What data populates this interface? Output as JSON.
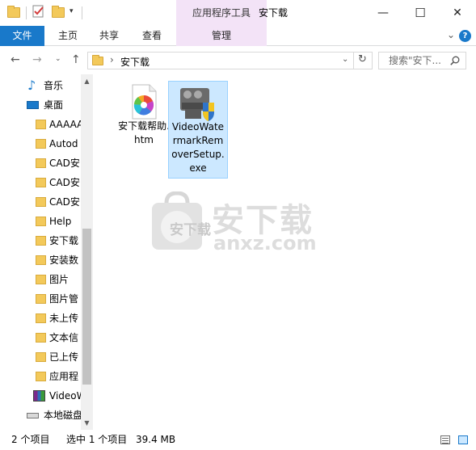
{
  "window": {
    "title": "安下载",
    "context_tab_title": "应用程序工具",
    "controls": {
      "minimize": "—",
      "maximize": "☐",
      "close": "✕"
    }
  },
  "ribbon": {
    "tabs": [
      {
        "label": "文件"
      },
      {
        "label": "主页"
      },
      {
        "label": "共享"
      },
      {
        "label": "查看"
      },
      {
        "label": "管理"
      }
    ],
    "help": "?"
  },
  "address": {
    "path": "安下载",
    "search_placeholder": "搜索\"安下..."
  },
  "sidebar": {
    "items": [
      {
        "label": "音乐",
        "icon": "music-icon"
      },
      {
        "label": "桌面",
        "icon": "desktop-icon"
      },
      {
        "label": "AAAAA",
        "icon": "folder-icon"
      },
      {
        "label": "Autod",
        "icon": "folder-icon"
      },
      {
        "label": "CAD安",
        "icon": "folder-icon"
      },
      {
        "label": "CAD安",
        "icon": "folder-icon"
      },
      {
        "label": "CAD安",
        "icon": "folder-icon"
      },
      {
        "label": "Help",
        "icon": "folder-icon"
      },
      {
        "label": "安下载",
        "icon": "folder-icon"
      },
      {
        "label": "安装数",
        "icon": "folder-icon"
      },
      {
        "label": "图片",
        "icon": "folder-icon"
      },
      {
        "label": "图片管",
        "icon": "folder-icon"
      },
      {
        "label": "未上传",
        "icon": "folder-icon"
      },
      {
        "label": "文本信",
        "icon": "folder-icon"
      },
      {
        "label": "已上传",
        "icon": "folder-icon"
      },
      {
        "label": "应用程",
        "icon": "folder-icon"
      },
      {
        "label": "VideoW",
        "icon": "rar-icon"
      },
      {
        "label": "本地磁盘",
        "icon": "drive-icon"
      }
    ]
  },
  "files": [
    {
      "name": "安下载帮助.htm",
      "icon": "color-wheel-icon",
      "selected": false
    },
    {
      "name": "VideoWatermarkRemoverSetup.exe",
      "icon": "setup-film-icon",
      "selected": true
    }
  ],
  "watermark": {
    "cn": "安下载",
    "en": "anxz.com"
  },
  "status": {
    "count": "2 个项目",
    "selection": "选中 1 个项目",
    "size": "39.4 MB"
  },
  "colors": {
    "accent": "#1979ca",
    "context_tab": "#f3e3f7",
    "selection_bg": "#cce8ff",
    "selection_border": "#99d1ff",
    "folder": "#f3c95a"
  }
}
